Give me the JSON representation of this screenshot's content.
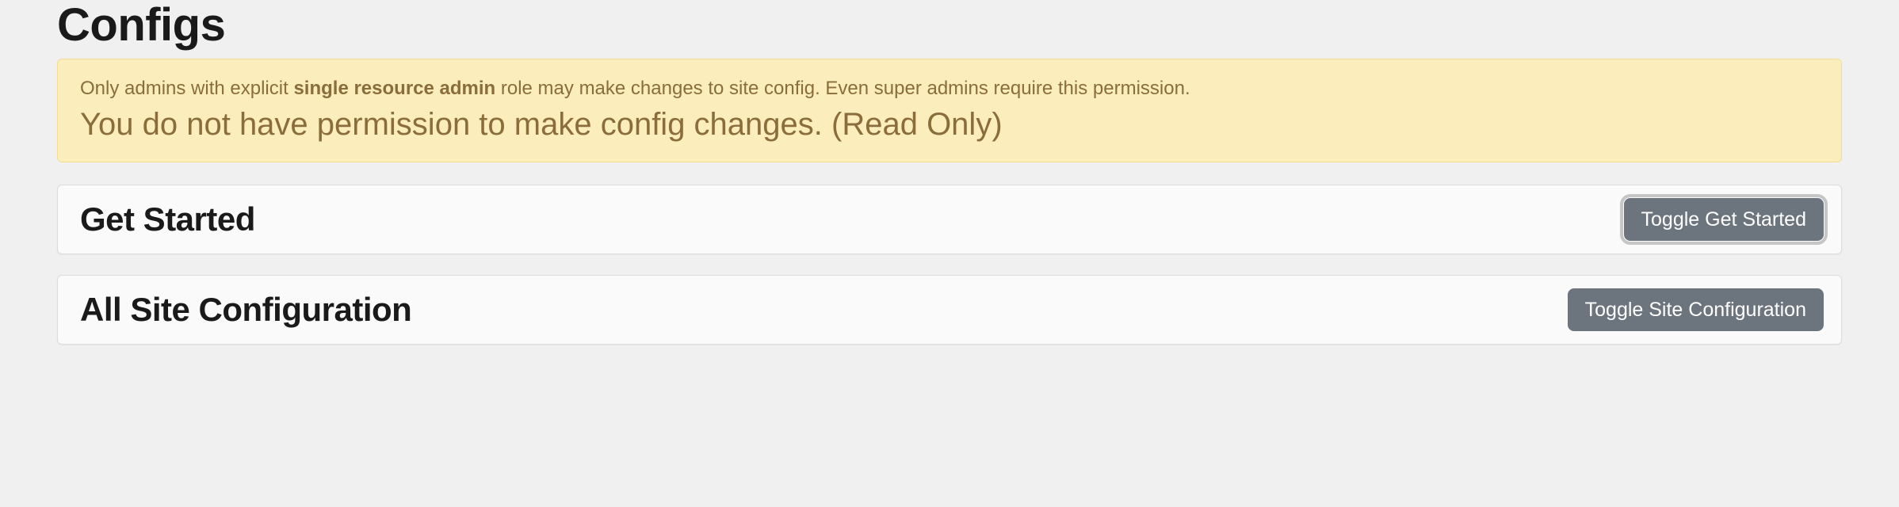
{
  "page": {
    "title": "Configs"
  },
  "alert": {
    "prefix": "Only admins with explicit ",
    "bold_role": "single resource admin",
    "suffix": " role may make changes to site config. Even super admins require this permission.",
    "main_message": "You do not have permission to make config changes. (Read Only)"
  },
  "panels": {
    "get_started": {
      "heading": "Get Started",
      "toggle_label": "Toggle Get Started"
    },
    "site_config": {
      "heading": "All Site Configuration",
      "toggle_label": "Toggle Site Configuration"
    }
  }
}
